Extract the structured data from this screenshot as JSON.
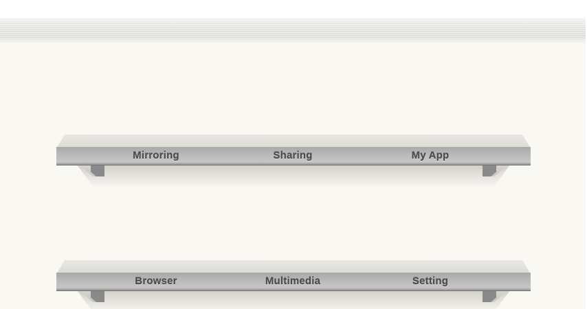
{
  "shelves": [
    {
      "items": [
        "Mirroring",
        "Sharing",
        "My App"
      ]
    },
    {
      "items": [
        "Browser",
        "Multimedia",
        "Setting"
      ]
    }
  ],
  "colors": {
    "background": "#faf8f3",
    "shelf_front": "#b8b8b8",
    "label_text": "#4a4a4a"
  }
}
